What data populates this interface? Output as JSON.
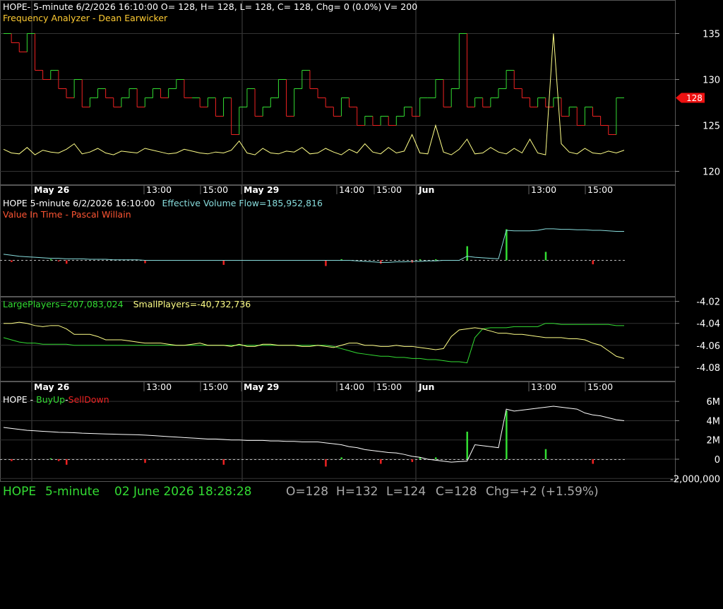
{
  "colors": {
    "up": "#33dd33",
    "down": "#ee2222",
    "yellow": "#ffff88",
    "cyan": "#88dddd",
    "white": "#ffffff",
    "grid": "#333333",
    "price_tag": "#ee1111"
  },
  "panel1": {
    "header_main": "HOPE- 5-minute 6/2/2026 16:10:00 O= 128, H= 128, L= 128, C= 128, Chg= 0 (0.0%) V= 200",
    "header_sub": "Frequency Analyzer - Dean Earwicker",
    "y_ticks": [
      "135",
      "130",
      "125",
      "120"
    ],
    "price_tag": "128"
  },
  "time_axis": {
    "labels": [
      "May 26",
      "13:00",
      "15:00",
      "May 29",
      "14:00",
      "15:00",
      "Jun",
      "13:00",
      "15:00"
    ],
    "bold": [
      true,
      false,
      false,
      true,
      false,
      false,
      true,
      false,
      false
    ]
  },
  "panel2": {
    "ticker_line": "HOPE 5-minute  6/2/2026 16:10:00",
    "evf_label": "Effective Volume Flow=185,952,816",
    "vit_label": "Value In Time - Pascal Willain"
  },
  "panel3": {
    "large_label": "LargePlayers=207,083,024",
    "small_label": "SmallPlayers=-40,732,736",
    "y_ticks": [
      "-4.02",
      "-4.04",
      "-4.06",
      "-4.08"
    ]
  },
  "panel4": {
    "prefix": "HOPE - ",
    "buy_label": "BuyUp",
    "dash": "-",
    "sell_label": "SellDown",
    "y_ticks": [
      "6M",
      "4M",
      "2M",
      "0",
      "-2,000,000"
    ]
  },
  "status": {
    "ticker": "HOPE",
    "interval": "5-minute",
    "datetime": "02 June 2026 18:28:28",
    "open": "O=128",
    "high": "H=132",
    "low": "L=124",
    "close": "C=128",
    "change": "Chg=+2 (+1.59%)"
  },
  "chart_data": [
    {
      "type": "line",
      "name": "price",
      "ylim": [
        118.5,
        136.5
      ],
      "y_ticks": [
        135,
        130,
        125,
        120
      ],
      "price_steps": [
        135,
        134,
        133,
        135,
        131,
        130,
        131,
        129,
        128,
        130,
        127,
        128,
        129,
        128,
        127,
        128,
        129,
        127,
        128,
        129,
        128,
        129,
        130,
        128,
        128,
        127,
        128,
        126,
        128,
        124,
        127,
        129,
        126,
        127,
        128,
        130,
        126,
        129,
        131,
        129,
        128,
        127,
        126,
        128,
        127,
        125,
        126,
        125,
        126,
        125,
        126,
        127,
        126,
        128,
        128,
        130,
        127,
        129,
        135,
        127,
        128,
        127,
        128,
        129,
        131,
        129,
        128,
        127,
        128,
        127,
        128,
        126,
        127,
        125,
        127,
        126,
        125,
        124,
        128,
        128
      ],
      "freq_analyzer": [
        122.4,
        122.0,
        121.9,
        122.6,
        121.8,
        122.3,
        122.1,
        122.0,
        122.4,
        123.0,
        121.9,
        122.1,
        122.5,
        122.0,
        121.8,
        122.2,
        122.1,
        122.0,
        122.5,
        122.3,
        122.1,
        121.9,
        122.0,
        122.4,
        122.2,
        122.0,
        121.9,
        122.1,
        122.0,
        122.3,
        123.3,
        122.0,
        121.8,
        122.5,
        122.0,
        121.9,
        122.2,
        122.1,
        122.6,
        121.9,
        122.0,
        122.5,
        122.1,
        121.8,
        122.4,
        122.0,
        123.0,
        122.1,
        121.9,
        122.6,
        122.0,
        122.2,
        124.0,
        122.0,
        121.9,
        125.0,
        122.1,
        121.8,
        122.4,
        123.5,
        121.9,
        122.0,
        122.6,
        122.1,
        121.9,
        122.5,
        122.0,
        123.5,
        122.0,
        121.8,
        135.0,
        123.0,
        122.1,
        121.9,
        122.5,
        122.0,
        121.9,
        122.2,
        122.0,
        122.3
      ]
    },
    {
      "type": "line",
      "name": "Effective Volume Flow",
      "evf": [
        0.78,
        0.76,
        0.74,
        0.73,
        0.72,
        0.71,
        0.7,
        0.7,
        0.69,
        0.69,
        0.69,
        0.68,
        0.68,
        0.68,
        0.67,
        0.67,
        0.67,
        0.67,
        0.66,
        0.66,
        0.66,
        0.66,
        0.66,
        0.66,
        0.66,
        0.66,
        0.66,
        0.66,
        0.66,
        0.66,
        0.66,
        0.66,
        0.66,
        0.66,
        0.66,
        0.66,
        0.66,
        0.66,
        0.66,
        0.66,
        0.66,
        0.66,
        0.66,
        0.66,
        0.66,
        0.65,
        0.64,
        0.63,
        0.62,
        0.62,
        0.63,
        0.63,
        0.64,
        0.64,
        0.65,
        0.65,
        0.66,
        0.66,
        0.66,
        0.74,
        0.72,
        0.71,
        0.7,
        0.69,
        1.25,
        1.24,
        1.24,
        1.24,
        1.25,
        1.28,
        1.28,
        1.27,
        1.27,
        1.26,
        1.26,
        1.25,
        1.25,
        1.24,
        1.23,
        1.23
      ],
      "vit_bars": [
        0,
        -0.03,
        0,
        0,
        0,
        0,
        0.02,
        -0.02,
        -0.06,
        0,
        0,
        0,
        0,
        0,
        0,
        0,
        0,
        0,
        -0.05,
        0,
        0,
        0,
        0,
        0,
        0,
        0,
        0,
        0,
        -0.08,
        0,
        0,
        0,
        0,
        0,
        0,
        0,
        0,
        0,
        0,
        0,
        0,
        -0.1,
        0,
        0.02,
        0,
        0,
        0,
        0,
        -0.06,
        0,
        0,
        0,
        -0.04,
        0.02,
        0,
        0.02,
        0,
        0,
        0,
        0.25,
        0,
        0,
        0,
        0,
        0.55,
        0,
        0,
        0,
        0,
        0.15,
        0,
        0,
        0,
        0,
        0,
        -0.07,
        0,
        0,
        0,
        0
      ]
    },
    {
      "type": "line",
      "name": "Large/Small Players",
      "ylim": [
        -4.093,
        -4.017
      ],
      "y_ticks": [
        -4.02,
        -4.04,
        -4.06,
        -4.08
      ],
      "large_players": [
        -4.053,
        -4.055,
        -4.057,
        -4.058,
        -4.058,
        -4.059,
        -4.059,
        -4.059,
        -4.059,
        -4.06,
        -4.06,
        -4.06,
        -4.06,
        -4.06,
        -4.06,
        -4.06,
        -4.06,
        -4.06,
        -4.06,
        -4.06,
        -4.06,
        -4.06,
        -4.06,
        -4.06,
        -4.06,
        -4.06,
        -4.06,
        -4.06,
        -4.06,
        -4.06,
        -4.06,
        -4.06,
        -4.06,
        -4.06,
        -4.06,
        -4.06,
        -4.06,
        -4.06,
        -4.06,
        -4.06,
        -4.06,
        -4.06,
        -4.061,
        -4.063,
        -4.065,
        -4.067,
        -4.068,
        -4.069,
        -4.07,
        -4.07,
        -4.071,
        -4.071,
        -4.072,
        -4.072,
        -4.073,
        -4.073,
        -4.074,
        -4.075,
        -4.075,
        -4.076,
        -4.053,
        -4.045,
        -4.044,
        -4.044,
        -4.044,
        -4.043,
        -4.043,
        -4.043,
        -4.043,
        -4.04,
        -4.04,
        -4.041,
        -4.041,
        -4.041,
        -4.041,
        -4.041,
        -4.041,
        -4.041,
        -4.042,
        -4.042
      ],
      "small_players": [
        -4.04,
        -4.04,
        -4.039,
        -4.04,
        -4.042,
        -4.043,
        -4.042,
        -4.042,
        -4.045,
        -4.05,
        -4.05,
        -4.05,
        -4.052,
        -4.055,
        -4.055,
        -4.055,
        -4.056,
        -4.057,
        -4.058,
        -4.058,
        -4.058,
        -4.059,
        -4.06,
        -4.06,
        -4.059,
        -4.058,
        -4.06,
        -4.06,
        -4.06,
        -4.061,
        -4.059,
        -4.061,
        -4.061,
        -4.059,
        -4.059,
        -4.06,
        -4.06,
        -4.06,
        -4.061,
        -4.061,
        -4.06,
        -4.061,
        -4.062,
        -4.06,
        -4.058,
        -4.058,
        -4.06,
        -4.06,
        -4.061,
        -4.061,
        -4.06,
        -4.061,
        -4.061,
        -4.062,
        -4.063,
        -4.064,
        -4.063,
        -4.052,
        -4.046,
        -4.045,
        -4.044,
        -4.045,
        -4.047,
        -4.049,
        -4.049,
        -4.05,
        -4.05,
        -4.051,
        -4.052,
        -4.053,
        -4.053,
        -4.053,
        -4.054,
        -4.054,
        -4.055,
        -4.058,
        -4.06,
        -4.065,
        -4.07,
        -4.072
      ]
    },
    {
      "type": "line",
      "name": "BuyUp-SellDown",
      "ylim": [
        -2200000,
        6600000
      ],
      "y_ticks": [
        6000000,
        4000000,
        2000000,
        0,
        -2000000
      ],
      "buy_sell": [
        3300000,
        3200000,
        3100000,
        3000000,
        2950000,
        2900000,
        2850000,
        2800000,
        2780000,
        2750000,
        2700000,
        2680000,
        2650000,
        2620000,
        2600000,
        2580000,
        2560000,
        2540000,
        2500000,
        2460000,
        2400000,
        2350000,
        2300000,
        2250000,
        2200000,
        2150000,
        2100000,
        2100000,
        2050000,
        2000000,
        2000000,
        1950000,
        1950000,
        1950000,
        1900000,
        1900000,
        1850000,
        1850000,
        1800000,
        1800000,
        1800000,
        1700000,
        1600000,
        1500000,
        1300000,
        1200000,
        1000000,
        900000,
        800000,
        700000,
        650000,
        500000,
        300000,
        200000,
        0,
        -100000,
        -200000,
        -300000,
        -250000,
        -200000,
        1500000,
        1400000,
        1300000,
        1200000,
        5200000,
        5000000,
        5100000,
        5200000,
        5300000,
        5400000,
        5500000,
        5400000,
        5300000,
        5200000,
        4800000,
        4600000,
        4500000,
        4300000,
        4100000,
        4000000
      ],
      "bars": [
        0,
        -0.2,
        0,
        0,
        0,
        0,
        0.1,
        -0.2,
        -0.6,
        0,
        0,
        0,
        0,
        0,
        0,
        0,
        0,
        0,
        -0.4,
        0,
        0,
        0,
        0,
        0,
        0,
        0,
        0,
        0,
        -0.6,
        0,
        0,
        0,
        0,
        0,
        0,
        0,
        0,
        0,
        0,
        0,
        0,
        -0.8,
        0,
        0.2,
        0,
        0,
        0,
        0,
        -0.5,
        0,
        0,
        0,
        -0.3,
        0.2,
        0,
        0.2,
        0,
        0,
        0,
        3.0,
        0,
        0,
        0,
        0,
        5.3,
        0,
        0,
        0,
        0,
        1.1,
        0,
        0,
        0,
        0,
        0,
        -0.5,
        0,
        0,
        0,
        0
      ]
    }
  ]
}
